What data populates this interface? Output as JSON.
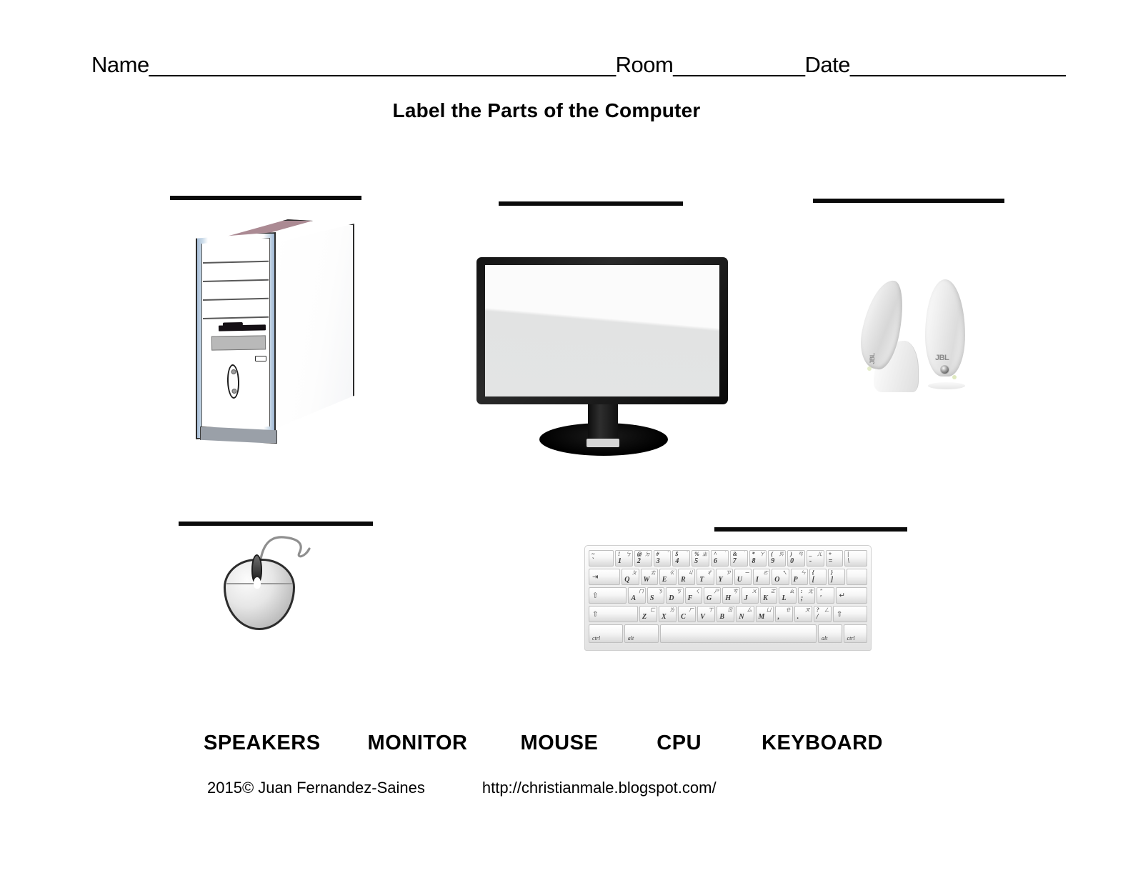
{
  "document": {
    "type": "worksheet",
    "title": "Label the Parts of the Computer"
  },
  "header": {
    "name_label": "Name",
    "name_blank": "_______________________________________",
    "room_label": "Room",
    "room_blank": "___________",
    "date_label": "Date",
    "date_blank": "__________________"
  },
  "answer_blanks": [
    {
      "id": "blank-cpu",
      "for_image": "cpu-tower"
    },
    {
      "id": "blank-monitor",
      "for_image": "monitor"
    },
    {
      "id": "blank-speakers",
      "for_image": "speakers"
    },
    {
      "id": "blank-mouse",
      "for_image": "mouse"
    },
    {
      "id": "blank-keyboard",
      "for_image": "keyboard"
    }
  ],
  "images": {
    "cpu": {
      "name": "computer-tower-illustration",
      "answer": "CPU"
    },
    "monitor": {
      "name": "lcd-monitor-illustration",
      "answer": "MONITOR"
    },
    "speakers": {
      "name": "jbl-speakers-illustration",
      "answer": "SPEAKERS",
      "brand": "JBL"
    },
    "mouse": {
      "name": "computer-mouse-illustration",
      "answer": "MOUSE"
    },
    "keyboard": {
      "name": "computer-keyboard-illustration",
      "answer": "KEYBOARD"
    }
  },
  "keyboard": {
    "rows": [
      [
        {
          "main": "`",
          "up": "~",
          "w": 1.45,
          "alt": ""
        },
        {
          "main": "1",
          "up": "!",
          "alt": "ㄅ",
          "w": 1
        },
        {
          "main": "2",
          "up": "@",
          "alt": "ㄉ",
          "w": 1
        },
        {
          "main": "3",
          "up": "#",
          "alt": "ˇ",
          "w": 1
        },
        {
          "main": "4",
          "up": "$",
          "alt": "ˋ",
          "w": 1
        },
        {
          "main": "5",
          "up": "%",
          "alt": "ㄓ",
          "w": 1
        },
        {
          "main": "6",
          "up": "^",
          "alt": "ˊ",
          "w": 1
        },
        {
          "main": "7",
          "up": "&",
          "alt": "˙",
          "w": 1
        },
        {
          "main": "8",
          "up": "*",
          "alt": "ㄚ",
          "w": 1
        },
        {
          "main": "9",
          "up": "(",
          "alt": "ㄞ",
          "w": 1
        },
        {
          "main": "0",
          "up": ")",
          "alt": "ㄢ",
          "w": 1
        },
        {
          "main": "-",
          "up": "_",
          "alt": "ㄦ",
          "w": 1
        },
        {
          "main": "=",
          "up": "+",
          "alt": "",
          "w": 1
        },
        {
          "main": "\\",
          "up": "|",
          "alt": "",
          "w": 1.3
        }
      ],
      [
        {
          "glyph": "⇥",
          "w": 1.9
        },
        {
          "main": "Q",
          "alt": "ㄆ",
          "w": 1
        },
        {
          "main": "W",
          "alt": "ㄊ",
          "w": 1
        },
        {
          "main": "E",
          "alt": "ㄍ",
          "w": 1
        },
        {
          "main": "R",
          "alt": "ㄐ",
          "w": 1
        },
        {
          "main": "T",
          "alt": "ㄔ",
          "w": 1
        },
        {
          "main": "Y",
          "alt": "ㄗ",
          "w": 1
        },
        {
          "main": "U",
          "alt": "ㄧ",
          "w": 1
        },
        {
          "main": "I",
          "alt": "ㄛ",
          "w": 1
        },
        {
          "main": "O",
          "alt": "ㄟ",
          "w": 1
        },
        {
          "main": "P",
          "alt": "ㄣ",
          "w": 1
        },
        {
          "main": "[",
          "up": "{",
          "w": 1
        },
        {
          "main": "]",
          "up": "}",
          "w": 1
        },
        {
          "main": "",
          "w": 1.2
        }
      ],
      [
        {
          "glyph": "⇧",
          "w": 2.3
        },
        {
          "main": "A",
          "alt": "ㄇ",
          "w": 1
        },
        {
          "main": "S",
          "alt": "ㄋ",
          "w": 1
        },
        {
          "main": "D",
          "alt": "ㄎ",
          "w": 1
        },
        {
          "main": "F",
          "alt": "ㄑ",
          "w": 1
        },
        {
          "main": "G",
          "alt": "ㄕ",
          "w": 1
        },
        {
          "main": "H",
          "alt": "ㄘ",
          "w": 1
        },
        {
          "main": "J",
          "alt": "ㄨ",
          "w": 1
        },
        {
          "main": "K",
          "alt": "ㄜ",
          "w": 1
        },
        {
          "main": "L",
          "alt": "ㄠ",
          "w": 1
        },
        {
          "main": ";",
          "up": ":",
          "alt": "ㄤ",
          "w": 1
        },
        {
          "main": "'",
          "up": "\"",
          "w": 1
        },
        {
          "glyph": "↵",
          "w": 1.9
        }
      ],
      [
        {
          "glyph": "⇧",
          "w": 2.9
        },
        {
          "main": "Z",
          "alt": "ㄈ",
          "w": 1
        },
        {
          "main": "X",
          "alt": "ㄌ",
          "w": 1
        },
        {
          "main": "C",
          "alt": "ㄏ",
          "w": 1
        },
        {
          "main": "V",
          "alt": "ㄒ",
          "w": 1
        },
        {
          "main": "B",
          "alt": "ㄖ",
          "w": 1
        },
        {
          "main": "N",
          "alt": "ㄙ",
          "w": 1
        },
        {
          "main": "M",
          "alt": "ㄩ",
          "w": 1
        },
        {
          "main": ",",
          "alt": "ㄝ",
          "w": 1
        },
        {
          "main": ".",
          "alt": "ㄡ",
          "w": 1
        },
        {
          "main": "/",
          "up": "?",
          "alt": "ㄥ",
          "w": 1
        },
        {
          "glyph": "⇧",
          "w": 2.0
        }
      ],
      [
        {
          "modlabel": "ctrl",
          "w": 1.6
        },
        {
          "modlabel": "alt",
          "w": 1.6
        },
        {
          "main": "",
          "w": 7.6
        },
        {
          "modlabel": "alt",
          "w": 1.1
        },
        {
          "modlabel": "ctrl",
          "w": 1.1
        }
      ]
    ]
  },
  "word_bank": {
    "words": [
      "SPEAKERS",
      "MONITOR",
      "MOUSE",
      "CPU",
      "KEYBOARD"
    ]
  },
  "footer": {
    "credit": "2015© Juan Fernandez-Saines",
    "url": "http://christianmale.blogspot.com/"
  },
  "colors": {
    "ink": "#000000",
    "page": "#ffffff",
    "blank_rule": "#0a0a0a",
    "cpu_top_accent": "#ab8a93",
    "cpu_side_accent": "#a8bfd8",
    "monitor_bezel": "#141414",
    "monitor_screen": "#eceded"
  }
}
